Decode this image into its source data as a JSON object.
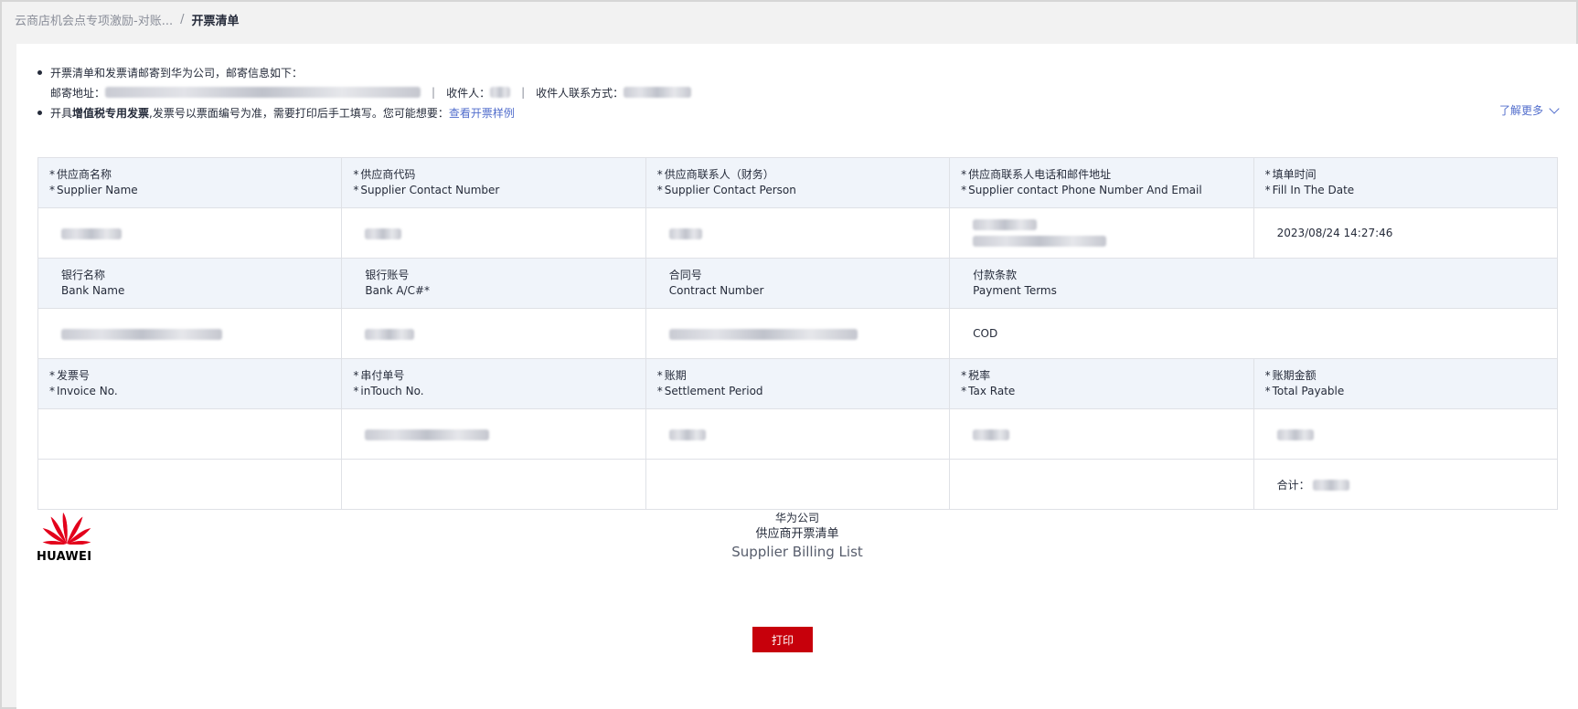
{
  "breadcrumb": {
    "parent": "云商店机会点专项激励-对账...",
    "separator": "/",
    "current": "开票清单"
  },
  "notes": {
    "line1": "开票清单和发票请邮寄到华为公司，邮寄信息如下：",
    "address_label": "邮寄地址：",
    "receiver_label": "收件人：",
    "contact_label": "收件人联系方式：",
    "pipe": "|",
    "line3_prefix": "开具",
    "line3_bold": "增值税专用发票",
    "line3_rest": ",发票号以票面编号为准，需要打印后手工填写。您可能想要：",
    "line3_link": "查看开票样例",
    "learn_more": "了解更多"
  },
  "table": {
    "star": "*",
    "row1_headers": [
      {
        "cn": "供应商名称",
        "en": "Supplier Name"
      },
      {
        "cn": "供应商代码",
        "en": "Supplier Contact Number"
      },
      {
        "cn": "供应商联系人（财务）",
        "en": "Supplier Contact Person"
      },
      {
        "cn": "供应商联系人电话和邮件地址",
        "en": "Supplier contact Phone Number And Email"
      },
      {
        "cn": "填单时间",
        "en": "Fill In The Date"
      }
    ],
    "fill_date": "2023/08/24 14:27:46",
    "row2_headers": [
      {
        "cn": "银行名称",
        "en": "Bank Name"
      },
      {
        "cn": "银行账号",
        "en": "Bank A/C#*"
      },
      {
        "cn": "合同号",
        "en": "Contract Number"
      },
      {
        "cn": "付款条款",
        "en": "Payment Terms"
      }
    ],
    "payment_terms": "COD",
    "row3_headers": [
      {
        "cn": "发票号",
        "en": "Invoice No."
      },
      {
        "cn": "串付单号",
        "en": "inTouch No."
      },
      {
        "cn": "账期",
        "en": "Settlement Period"
      },
      {
        "cn": "税率",
        "en": "Tax Rate"
      },
      {
        "cn": "账期金额",
        "en": "Total Payable"
      }
    ],
    "total_label": "合计："
  },
  "footer": {
    "logo_text": "HUAWEI",
    "company": "华为公司",
    "title_cn": "供应商开票清单",
    "title_en": "Supplier Billing List",
    "print_label": "打印"
  },
  "colors": {
    "accent": "#c7000b",
    "link": "#526ecc",
    "header_bg": "#f0f4fa"
  },
  "icons": [
    "huawei-logo-icon",
    "chevron-down-icon"
  ]
}
